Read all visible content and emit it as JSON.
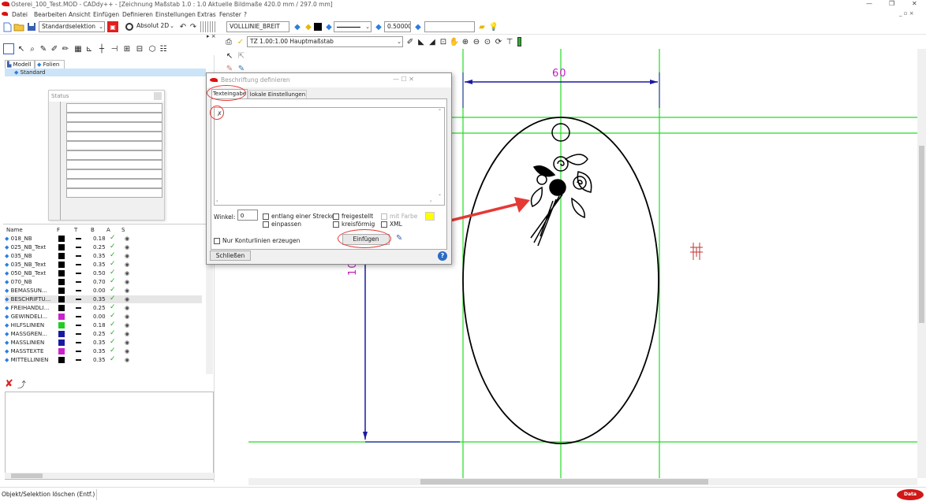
{
  "window": {
    "title": "Osterei_100_Test.MOD  -  CADdy++ - [Zeichnung   Maßstab 1.0 : 1.0   Aktuelle Bildmaße 420.0 mm / 297.0 mm]",
    "minimize": "—",
    "maximize": "❐",
    "close": "✕",
    "inner_controls": "_ ▫ ×"
  },
  "menu": [
    "Datei",
    "Bearbeiten",
    "Ansicht",
    "Einfügen",
    "Definieren",
    "Einstellungen",
    "Extras",
    "Fenster",
    "?"
  ],
  "toolbar": {
    "selection_mode": "Standardselektion",
    "coord_mode": "Absolut 2D",
    "line_layer": "VOLLLINIE_BREIT",
    "line_width": "0.500000",
    "scale_combo": "TZ 1.00:1.00 Hauptmaßstab"
  },
  "tree_tabs": {
    "model": "Modell",
    "layers": "Folien"
  },
  "tree": {
    "item": "Standard"
  },
  "status_panel": {
    "title": "Status"
  },
  "layer_table": {
    "headers": [
      "Name",
      "F",
      "T",
      "B",
      "A",
      "S"
    ],
    "rows": [
      {
        "name": "018_NB",
        "color": "#000000",
        "width": "0.18",
        "check": "✓",
        "eye": "👁"
      },
      {
        "name": "025_NB_Text",
        "color": "#000000",
        "width": "0.25",
        "check": "✓",
        "eye": "👁"
      },
      {
        "name": "035_NB",
        "color": "#000000",
        "width": "0.35",
        "check": "✓",
        "eye": "👁"
      },
      {
        "name": "035_NB_Text",
        "color": "#000000",
        "width": "0.35",
        "check": "✓",
        "eye": "👁"
      },
      {
        "name": "050_NB_Text",
        "color": "#000000",
        "width": "0.50",
        "check": "✓",
        "eye": "👁"
      },
      {
        "name": "070_NB",
        "color": "#000000",
        "width": "0.70",
        "check": "✓",
        "eye": "👁"
      },
      {
        "name": "BEMASSUN...",
        "color": "#000000",
        "width": "0.00",
        "check": "✓",
        "eye": "👁"
      },
      {
        "name": "BESCHRIFTU...",
        "color": "#000000",
        "width": "0.35",
        "check": "✓",
        "eye": "👁"
      },
      {
        "name": "FREIHANDLI...",
        "color": "#000000",
        "width": "0.25",
        "check": "✓",
        "eye": "👁"
      },
      {
        "name": "GEWINDELI...",
        "color": "#cc22cc",
        "width": "0.00",
        "check": "✓",
        "eye": "👁"
      },
      {
        "name": "HILFSLINIEN",
        "color": "#22cc22",
        "width": "0.18",
        "check": "✓",
        "eye": "👁"
      },
      {
        "name": "MASSGREN...",
        "color": "#1a1aa0",
        "width": "0.25",
        "check": "✓",
        "eye": "👁"
      },
      {
        "name": "MASSLINIEN",
        "color": "#1a1aa0",
        "width": "0.35",
        "check": "✓",
        "eye": "👁"
      },
      {
        "name": "MASSTEXTE",
        "color": "#cc22cc",
        "width": "0.35",
        "check": "✓",
        "eye": "👁"
      },
      {
        "name": "MITTELLINIEN",
        "color": "#000000",
        "width": "0.35",
        "check": "✓",
        "eye": "👁"
      }
    ]
  },
  "dialog": {
    "title": "Beschriftung definieren",
    "tab_text": "Texteingabe",
    "tab_local": "lokale Einstellungen",
    "text_value": "",
    "angle_label": "Winkel:",
    "angle_value": "0",
    "opt_along": "entlang einer Strecke",
    "opt_fit": "einpassen",
    "opt_free": "freigestellt",
    "opt_circular": "kreisförmig",
    "opt_color": "mit Farbe",
    "opt_xml": "XML",
    "opt_contour": "Nur Konturlinien erzeugen",
    "insert_button": "Einfügen",
    "close_button": "Schließen",
    "help": "?",
    "controls": "—   ☐   ✕",
    "color_swatch": "#ffff00"
  },
  "drawing": {
    "dim_width": "60",
    "dim_height": "100",
    "dim_color": "#c020c0",
    "aux_color": "#22dd22",
    "dim_line_color": "#1a1aa0"
  },
  "statusbar": {
    "message": "Objekt/Selektion löschen (Entf.)",
    "logo": "Data Solid"
  }
}
